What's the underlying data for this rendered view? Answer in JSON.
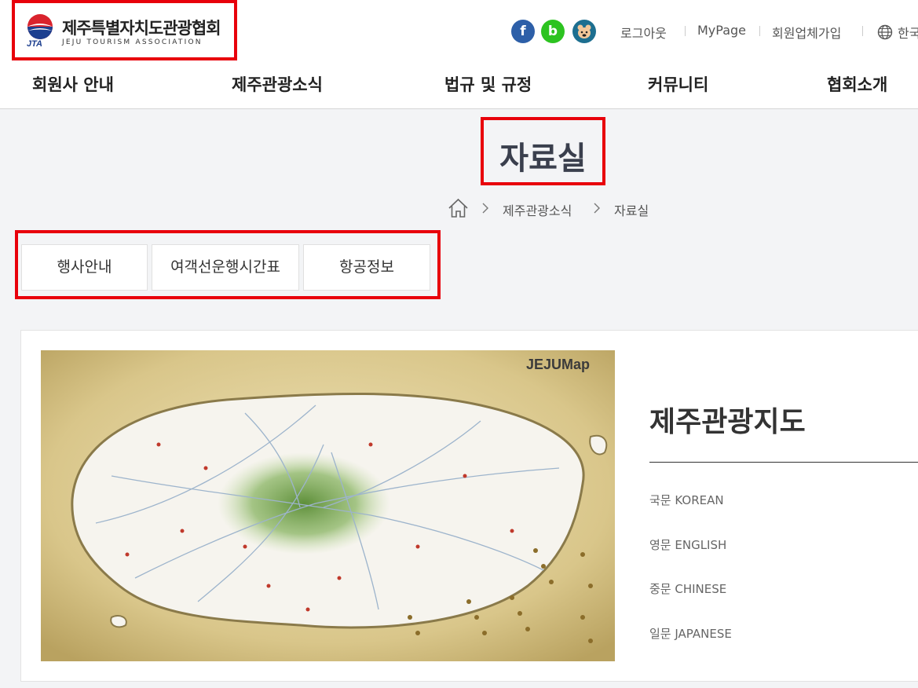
{
  "header": {
    "logo_ko": "제주특별자치도관광협회",
    "logo_en": "JEJU TOURISM ASSOCIATION",
    "logo_mark": "JTA",
    "sns": [
      "f",
      "b",
      "kakaostory-icon"
    ],
    "util": {
      "logout": "로그아웃",
      "mypage": "MyPage",
      "join": "회원업체가입",
      "lang": "한국어"
    },
    "gnb": [
      "회원사 안내",
      "제주관광소식",
      "법규 및 규정",
      "커뮤니티",
      "협회소개"
    ]
  },
  "page": {
    "title": "자료실",
    "breadcrumb": [
      "제주관광소식",
      "자료실"
    ]
  },
  "tabs": [
    "행사안내",
    "여객선운행시간표",
    "항공정보"
  ],
  "content": {
    "map_title": "제주관광지도",
    "map_logo": "JEJUMap",
    "languages": [
      "국문 KOREAN",
      "영문 ENGLISH",
      "중문 CHINESE",
      "일문 JAPANESE"
    ]
  },
  "colors": {
    "highlight": "#e8000b",
    "facebook": "#2d5fa8",
    "blog": "#2cc320",
    "kakao": "#1d6f90"
  }
}
